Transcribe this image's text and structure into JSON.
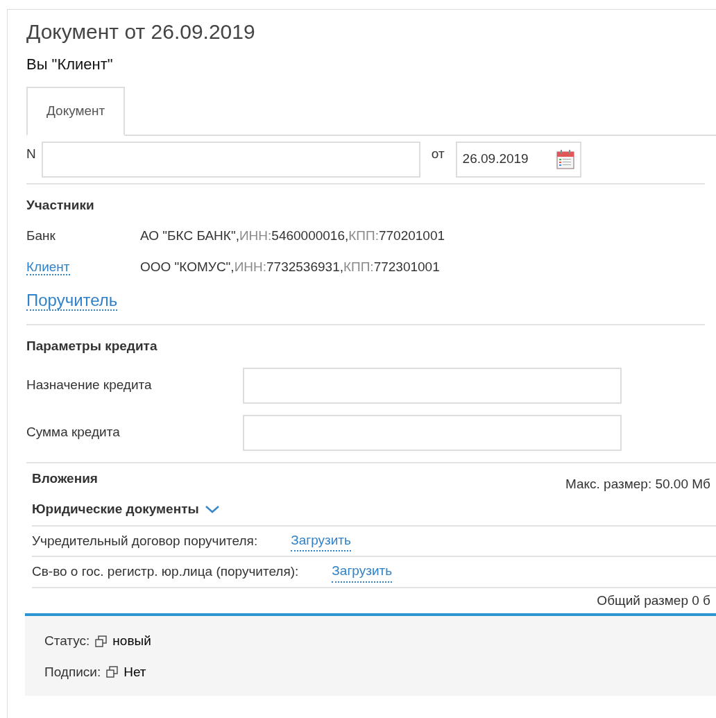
{
  "title": "Документ от 26.09.2019",
  "subtitle": "Вы \"Клиент\"",
  "tabs": [
    {
      "label": "Документ",
      "selected": true
    }
  ],
  "number_field": {
    "label": "N"
  },
  "date_field": {
    "label": "от",
    "value": "26.09.2019"
  },
  "participants": {
    "heading": "Участники",
    "rows": [
      {
        "role": "Банк",
        "kind": "text",
        "name": "АО \"БКС БАНК\",",
        "inn_label": "ИНН:",
        "inn": "5460000016,",
        "kpp_label": "КПП:",
        "kpp": "770201001"
      },
      {
        "role": "Клиент",
        "kind": "link",
        "name": "ООО \"КОМУС\",",
        "inn_label": "ИНН:",
        "inn": "7732536931,",
        "kpp_label": "КПП:",
        "kpp": "772301001"
      }
    ],
    "guarantor_link": "Поручитель"
  },
  "credit": {
    "heading": "Параметры кредита",
    "fields": [
      {
        "label": "Назначение кредита"
      },
      {
        "label": "Сумма кредита"
      }
    ]
  },
  "attachments": {
    "heading": "Вложения",
    "max_size": "Макс. размер: 50.00 Мб",
    "group": {
      "title": "Юридические документы",
      "expanded": true,
      "items": [
        {
          "label": "Учредительный договор поручителя:",
          "action": "Загрузить"
        },
        {
          "label": "Св-во о гос. регистр. юр.лица (поручителя):",
          "action": "Загрузить"
        }
      ]
    },
    "total": "Общий размер 0 б"
  },
  "footer": [
    {
      "label": "Статус:",
      "value": "новый"
    },
    {
      "label": "Подписи:",
      "value": "Нет"
    }
  ]
}
